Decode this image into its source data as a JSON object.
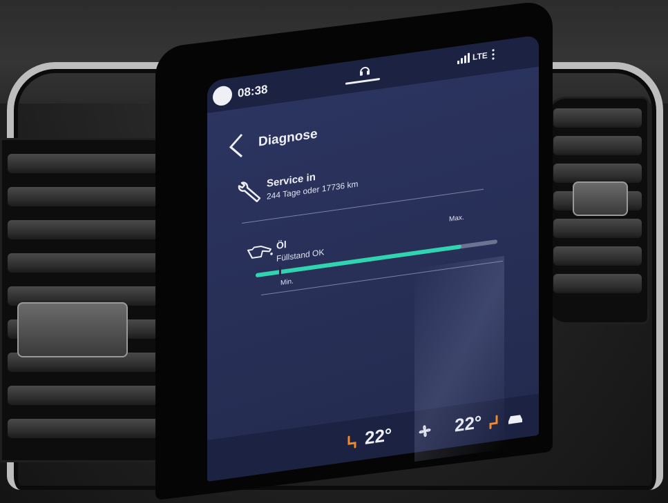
{
  "status_bar": {
    "time": "08:38",
    "network": "LTE",
    "icons": [
      "avatar-icon",
      "headset-icon",
      "signal-icon",
      "more-icon"
    ]
  },
  "header": {
    "title": "Diagnose",
    "back_icon": "chevron-left-icon"
  },
  "service": {
    "icon": "wrench-icon",
    "title": "Service in",
    "detail": "244 Tage oder 17736 km"
  },
  "oil": {
    "icon": "oil-can-icon",
    "title": "Öl",
    "status": "Füllstand OK",
    "level": 0.85,
    "max_label": "Max.",
    "min_label": "Min."
  },
  "climate": {
    "left_temp": "22°",
    "right_temp": "22°",
    "icons": [
      "seat-heat-left-icon",
      "fan-icon",
      "seat-heat-right-icon",
      "car-icon"
    ]
  },
  "colors": {
    "screen_bg": "#283058",
    "bar_fill": "#2fd4b0",
    "bar_track": "#6d7493",
    "seat_heat": "#f08a2a"
  }
}
